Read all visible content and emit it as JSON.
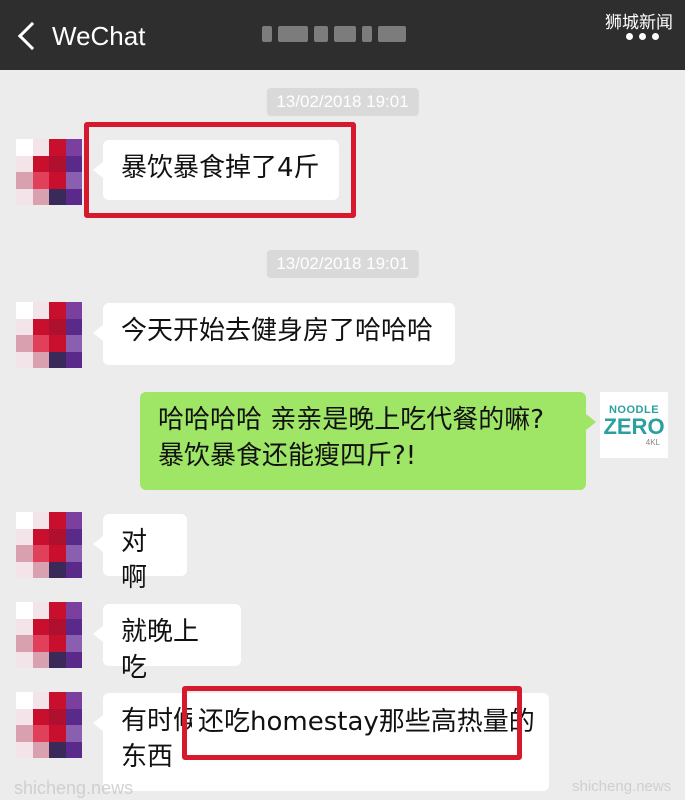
{
  "header": {
    "back_label": "WeChat",
    "watermark": "狮城新闻",
    "menu_icon": "more-dots-icon"
  },
  "messages": [
    {
      "type": "time",
      "text": "13/02/2018 19:01"
    },
    {
      "type": "left",
      "text": "暴饮暴食掉了4斤",
      "highlighted": true
    },
    {
      "type": "time",
      "text": "13/02/2018 19:01"
    },
    {
      "type": "left",
      "text": "今天开始去健身房了哈哈哈"
    },
    {
      "type": "right",
      "lines": [
        "哈哈哈哈 亲亲是晚上吃代餐的嘛?",
        "暴饮暴食还能瘦四斤?!"
      ]
    },
    {
      "type": "left",
      "text": "对啊"
    },
    {
      "type": "left",
      "text": "就晚上吃"
    },
    {
      "type": "left",
      "lines": [
        "有时候",
        "东西"
      ],
      "overlay": "还吃homestay那些高热量的"
    }
  ],
  "brand_logo": {
    "line1": "NOODLE",
    "line2": "ZERO",
    "line3": "4KL"
  },
  "watermarks": {
    "bottom_left": "shicheng.news",
    "bottom_right": "shicheng.news"
  },
  "colors": {
    "topbar": "#2e2e2e",
    "chat_bg": "#ececec",
    "green_bubble": "#9fe566",
    "highlight": "#d7192d"
  }
}
